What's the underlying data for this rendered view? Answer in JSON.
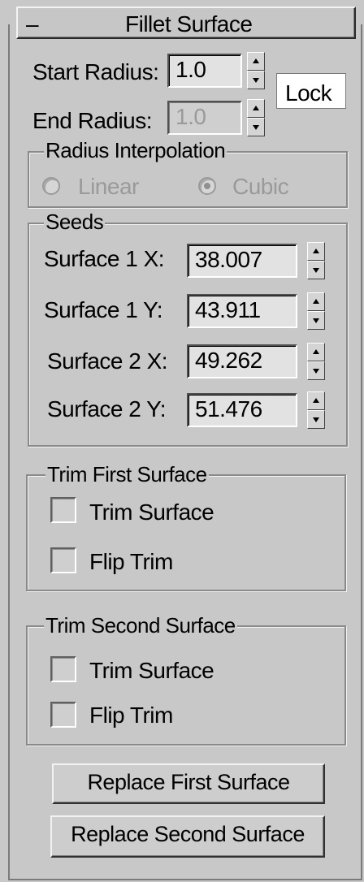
{
  "rollout": {
    "collapse_glyph": "–",
    "title": "Fillet Surface"
  },
  "radius": {
    "start_label": "Start Radius:",
    "start_value": "1.0",
    "end_label": "End Radius:",
    "end_value": "1.0",
    "lock_label": "Lock"
  },
  "interpolation": {
    "title": "Radius Interpolation",
    "options": [
      {
        "label": "Linear",
        "checked": false
      },
      {
        "label": "Cubic",
        "checked": true
      }
    ]
  },
  "seeds": {
    "title": "Seeds",
    "rows": [
      {
        "label": "Surface 1 X:",
        "value": "38.007"
      },
      {
        "label": "Surface 1 Y:",
        "value": "43.911"
      },
      {
        "label": "Surface 2 X:",
        "value": "49.262"
      },
      {
        "label": "Surface 2 Y:",
        "value": "51.476"
      }
    ]
  },
  "trim_first": {
    "title": "Trim First Surface",
    "trim_label": "Trim Surface",
    "flip_label": "Flip Trim"
  },
  "trim_second": {
    "title": "Trim Second Surface",
    "trim_label": "Trim Surface",
    "flip_label": "Flip Trim"
  },
  "buttons": {
    "replace_first": "Replace First Surface",
    "replace_second": "Replace Second Surface"
  }
}
